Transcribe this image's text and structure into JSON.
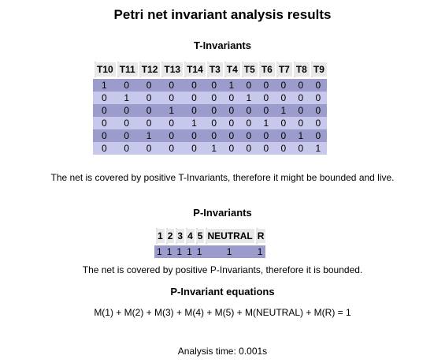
{
  "page": {
    "title": "Petri net invariant analysis results"
  },
  "t_invariants": {
    "heading": "T-Invariants",
    "columns": [
      "T10",
      "T11",
      "T12",
      "T13",
      "T14",
      "T3",
      "T4",
      "T5",
      "T6",
      "T7",
      "T8",
      "T9"
    ],
    "rows": [
      [
        "1",
        "0",
        "0",
        "0",
        "0",
        "0",
        "1",
        "0",
        "0",
        "0",
        "0",
        "0"
      ],
      [
        "0",
        "1",
        "0",
        "0",
        "0",
        "0",
        "0",
        "1",
        "0",
        "0",
        "0",
        "0"
      ],
      [
        "0",
        "0",
        "0",
        "1",
        "0",
        "0",
        "0",
        "0",
        "0",
        "1",
        "0",
        "0"
      ],
      [
        "0",
        "0",
        "0",
        "0",
        "1",
        "0",
        "0",
        "0",
        "1",
        "0",
        "0",
        "0"
      ],
      [
        "0",
        "0",
        "1",
        "0",
        "0",
        "0",
        "0",
        "0",
        "0",
        "0",
        "1",
        "0"
      ],
      [
        "0",
        "0",
        "0",
        "0",
        "0",
        "1",
        "0",
        "0",
        "0",
        "0",
        "0",
        "1"
      ]
    ],
    "summary": "The net is covered by positive T-Invariants, therefore it might be bounded and live."
  },
  "p_invariants": {
    "heading": "P-Invariants",
    "columns": [
      "1",
      "2",
      "3",
      "4",
      "5",
      "NEUTRAL",
      "R"
    ],
    "rows": [
      [
        "1",
        "1",
        "1",
        "1",
        "1",
        "1",
        "1"
      ]
    ],
    "summary": "The net is covered by positive P-Invariants, therefore it is bounded."
  },
  "p_equations": {
    "heading": "P-Invariant equations",
    "equation": "M(1) + M(2) + M(3) + M(4) + M(5) + M(NEUTRAL) + M(R) = 1"
  },
  "analysis": {
    "time_text": "Analysis time: 0.001s"
  },
  "colors": {
    "row_dark": "#9c9ccc",
    "row_light": "#c8c8ec",
    "header_bg": "#e8e8e8"
  }
}
